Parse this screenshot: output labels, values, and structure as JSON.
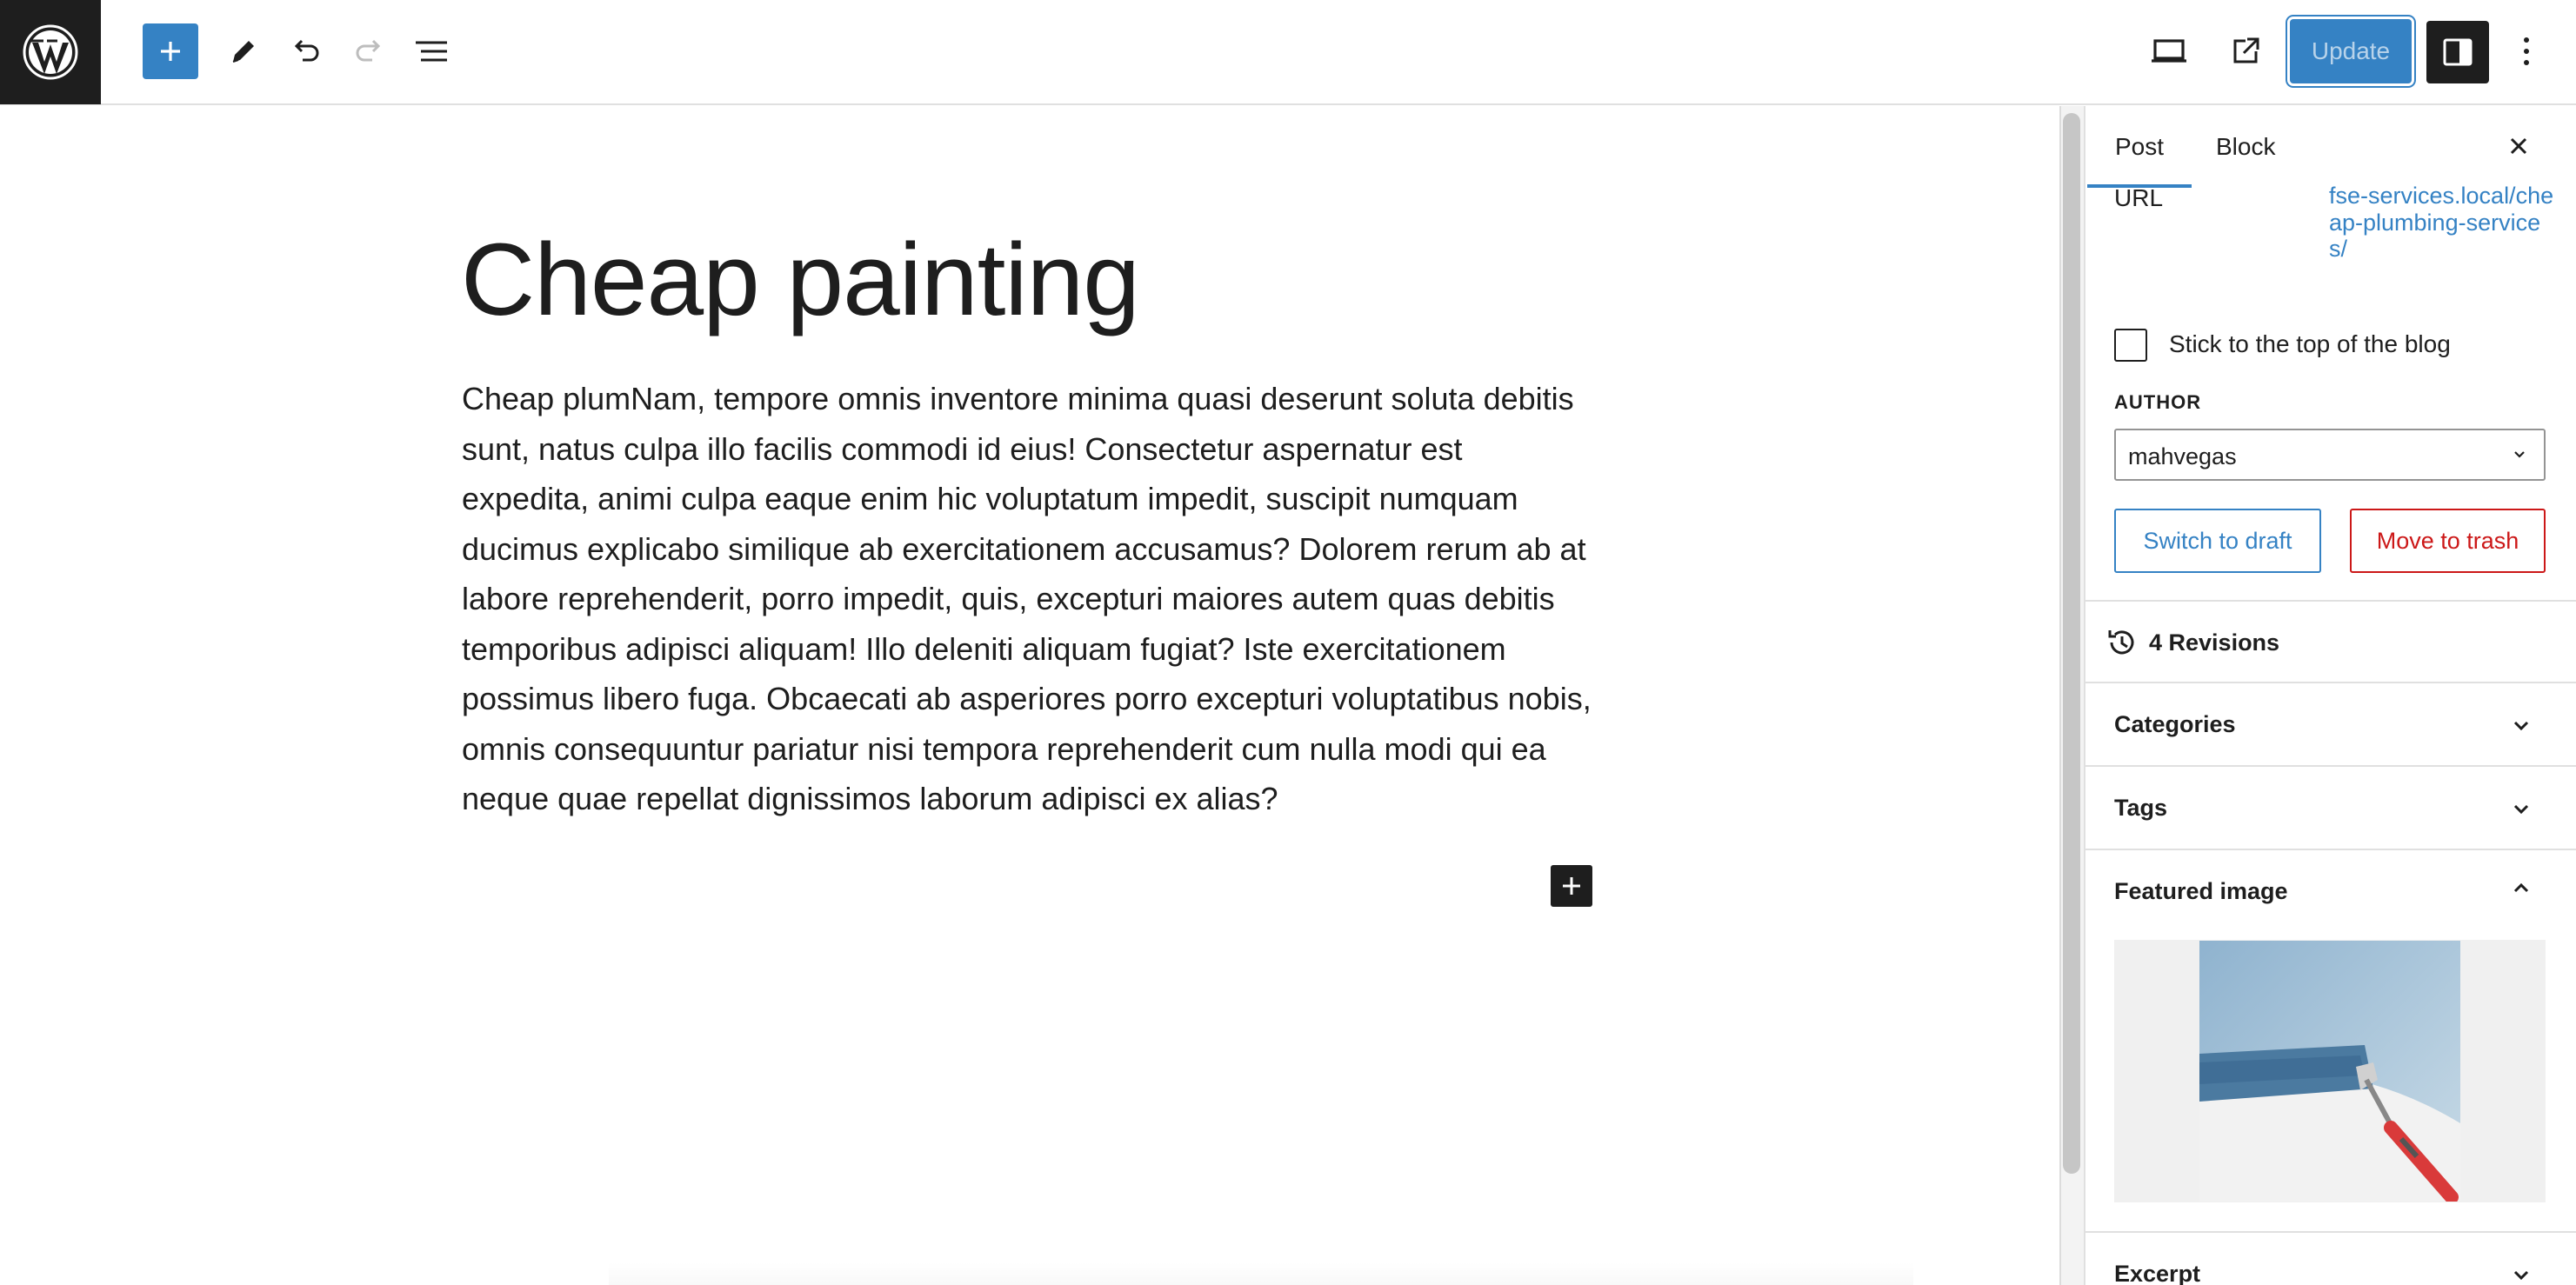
{
  "toolbar": {
    "add_block_tooltip": "Toggle block inserter",
    "update_label": "Update"
  },
  "post": {
    "title": "Cheap painting",
    "body": "Cheap plumNam, tempore omnis inventore minima quasi deserunt soluta debitis sunt, natus culpa illo facilis commodi id eius! Consectetur aspernatur est expedita, animi culpa eaque enim hic voluptatum impedit, suscipit numquam ducimus explicabo similique ab exercitationem accusamus? Dolorem rerum ab at labore reprehenderit, porro impedit, quis, excepturi maiores autem quas debitis temporibus adipisci aliquam! Illo deleniti aliquam fugiat? Iste exercitationem possimus libero fuga. Obcaecati ab asperiores porro excepturi voluptatibus nobis, omnis consequuntur pariatur nisi tempora reprehenderit cum nulla modi qui ea neque quae repellat dignissimos laborum adipisci ex alias?"
  },
  "sidebar": {
    "tabs": [
      {
        "label": "Post",
        "active": true
      },
      {
        "label": "Block",
        "active": false
      }
    ],
    "url_label": "URL",
    "url_value": "fse-services.local/cheap-plumbing-services/",
    "sticky_label": "Stick to the top of the blog",
    "sticky_checked": false,
    "author_heading": "AUTHOR",
    "author_value": "mahvegas",
    "switch_draft_label": "Switch to draft",
    "move_trash_label": "Move to trash",
    "revisions_label": "4 Revisions",
    "panels": {
      "categories": "Categories",
      "tags": "Tags",
      "featured_image": "Featured image",
      "excerpt": "Excerpt"
    }
  },
  "colors": {
    "accent": "#3582c4",
    "dark": "#1e1e1e",
    "danger": "#cc1818"
  },
  "icons": [
    "wordpress-logo-icon",
    "plus-icon",
    "pencil-icon",
    "undo-icon",
    "redo-icon",
    "list-view-icon",
    "desktop-preview-icon",
    "external-link-icon",
    "settings-sidebar-icon",
    "more-vertical-icon",
    "close-icon",
    "chevron-down-icon",
    "chevron-up-icon",
    "revisions-icon"
  ]
}
